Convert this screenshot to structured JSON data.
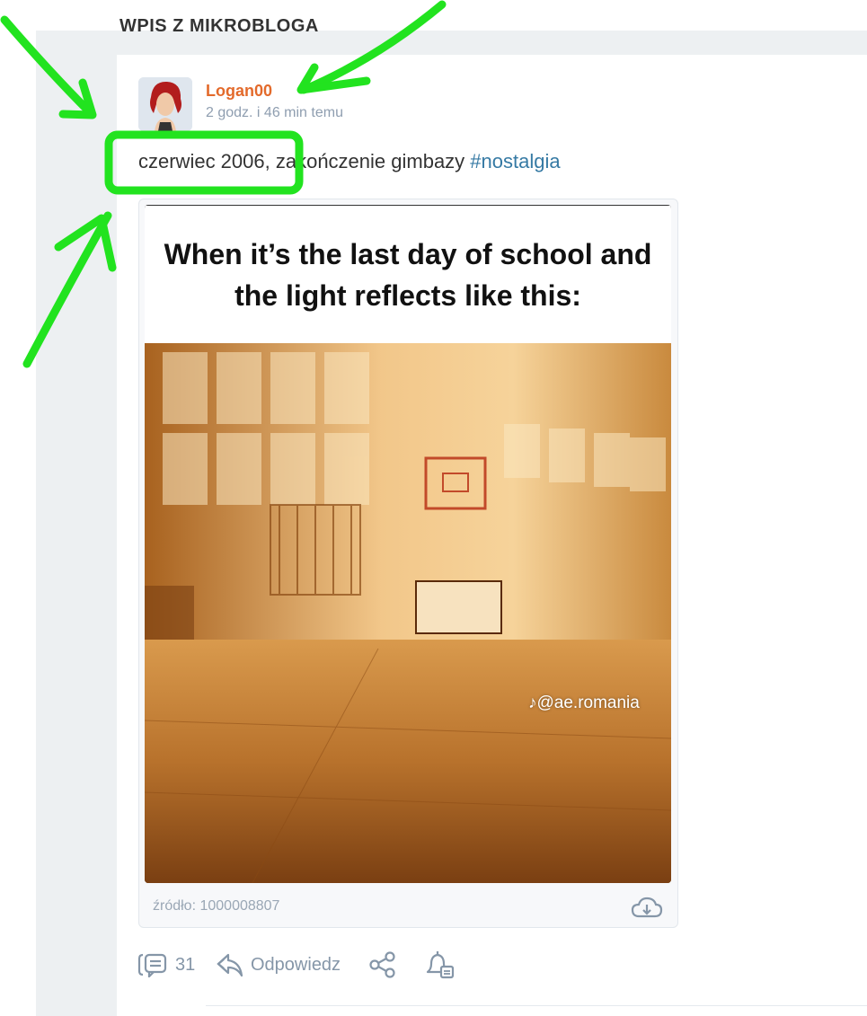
{
  "section": {
    "title": "WPIS Z MIKROBLOGA"
  },
  "post": {
    "author": "Logan00",
    "time": "2 godz. i 46 min temu",
    "body_text": "czerwiec 2006, zakończenie gimbazy ",
    "hashtag": "#nostalgia",
    "meme": {
      "caption": "When it’s the last day of school and the light reflects like this:",
      "watermark": "@ae.romania"
    },
    "source": "źródło: 1000008807"
  },
  "actions": {
    "comments_count": "31",
    "reply_label": "Odpowiedz"
  },
  "icons": {
    "comments": "comments-icon",
    "reply": "reply-icon",
    "share": "share-icon",
    "observe": "bell-icon",
    "download": "cloud-download-icon",
    "tiktok": "tiktok-icon"
  },
  "colors": {
    "author": "#e36a2b",
    "hashtag": "#367aa4",
    "muted": "#8596a8",
    "annotation": "#22e31f"
  }
}
